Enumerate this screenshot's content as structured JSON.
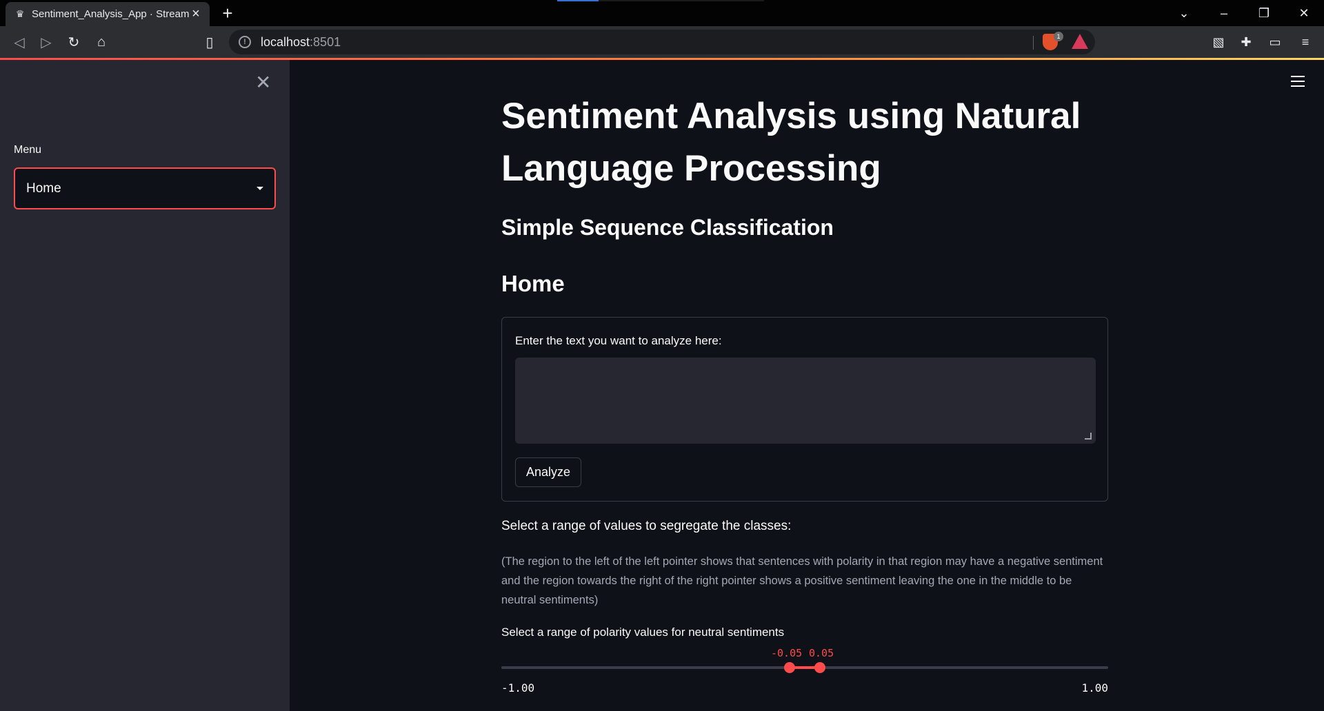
{
  "browser": {
    "tab_title": "Sentiment_Analysis_App · Streamlit",
    "url_host": "localhost",
    "url_port": ":8501",
    "brave_badge_count": "1"
  },
  "sidebar": {
    "menu_label": "Menu",
    "menu_selected": "Home"
  },
  "main": {
    "title": "Sentiment Analysis using Natural Language Processing",
    "subtitle": "Simple Sequence Classification",
    "section_heading": "Home",
    "text_input_label": "Enter the text you want to analyze here:",
    "text_input_value": "",
    "analyze_button": "Analyze",
    "range_heading": "Select a range of values to segregate the classes:",
    "range_help": "(The region to the left of the left pointer shows that sentences with polarity in that region may have a negative sentiment and the region towards the right of the right pointer shows a positive sentiment leaving the one in the middle to be neutral sentiments)",
    "slider": {
      "label": "Select a range of polarity values for neutral sentiments",
      "low": -0.05,
      "high": 0.05,
      "low_label": "-0.05",
      "high_label": "0.05",
      "min": -1.0,
      "max": 1.0,
      "min_label": "-1.00",
      "max_label": "1.00"
    }
  },
  "colors": {
    "accent": "#ff4b4b",
    "background": "#0e1117",
    "sidebar_bg": "#262730",
    "text": "#fafafa"
  }
}
